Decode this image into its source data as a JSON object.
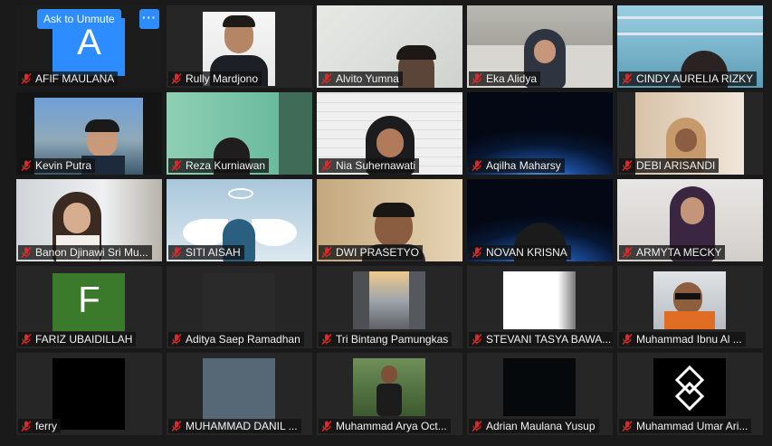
{
  "meeting": {
    "unmute_label": "Ask to Unmute",
    "more_label": "···"
  },
  "participants": [
    {
      "name": "AFIF MAULANA",
      "avatar_letter": "A",
      "avatar_color": "#2d8cff"
    },
    {
      "name": "Rully Mardjono"
    },
    {
      "name": "Alvito Yumna"
    },
    {
      "name": "Eka Alidya"
    },
    {
      "name": "CINDY AURELIA RIZKY"
    },
    {
      "name": "Kevin Putra"
    },
    {
      "name": "Reza Kurniawan"
    },
    {
      "name": "Nia Suhernawati"
    },
    {
      "name": "Aqilha Maharsy"
    },
    {
      "name": "DEBI ARISANDI"
    },
    {
      "name": "Banon Djinawi Sri Mu..."
    },
    {
      "name": "SITI AISAH"
    },
    {
      "name": "DWI PRASETYO"
    },
    {
      "name": "NOVAN KRISNA"
    },
    {
      "name": "ARMYTA MECKY"
    },
    {
      "name": "FARIZ UBAIDILLAH",
      "avatar_letter": "F",
      "avatar_color": "#3b7a2a"
    },
    {
      "name": "Aditya Saep Ramadhan"
    },
    {
      "name": "Tri Bintang Pamungkas"
    },
    {
      "name": "STEVANI TASYA BAWA..."
    },
    {
      "name": "Muhammad Ibnu Al ..."
    },
    {
      "name": "ferry"
    },
    {
      "name": "MUHAMMAD DANIL ..."
    },
    {
      "name": "Muhammad Arya Oct..."
    },
    {
      "name": "Adrian Maulana Yusup"
    },
    {
      "name": "Muhammad Umar Ari..."
    }
  ],
  "colors": {
    "accent": "#2d8cff",
    "muted_mic": "#e02828",
    "background": "#1a1a1a"
  }
}
